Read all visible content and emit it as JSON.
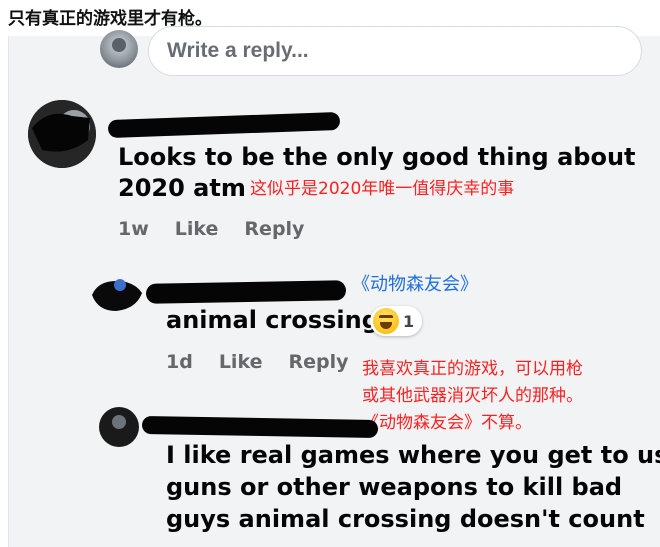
{
  "header": {
    "title": "只有真正的游戏里才有枪。"
  },
  "composer": {
    "placeholder": "Write a reply..."
  },
  "comments": [
    {
      "text_line1": "Looks to be the only good thing about",
      "text_line2": "2020 atm",
      "translation": "这似乎是2020年唯一值得庆幸的事",
      "time": "1w",
      "like_label": "Like",
      "reply_label": "Reply"
    },
    {
      "note": "《动物森友会》",
      "text": "animal crossing",
      "reaction_count": "1",
      "time": "1d",
      "like_label": "Like",
      "reply_label": "Reply",
      "translation_lines": [
        "我喜欢真正的游戏，可以用枪",
        "或其他武器消灭坏人的那种。",
        "《动物森友会》不算。"
      ]
    },
    {
      "text_lines": [
        "I like real games where you get to use",
        "guns or other weapons to kill bad",
        "guys animal crossing doesn't count"
      ]
    }
  ],
  "colors": {
    "translation": "#ff2020",
    "note": "#1f6fe0",
    "bubble": "#e4e6e9",
    "action": "#65676b"
  }
}
